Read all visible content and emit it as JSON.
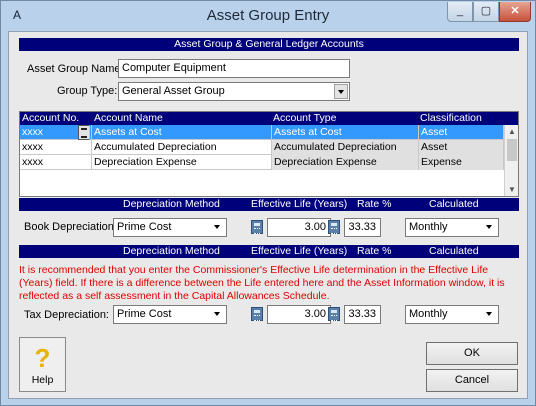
{
  "window": {
    "title": "Asset Group Entry",
    "app_icon": "app-icon"
  },
  "section1": {
    "header": "Asset Group & General Ledger Accounts"
  },
  "form": {
    "name_label": "Asset Group Name:",
    "name_value": "Computer Equipment",
    "type_label": "Group Type:",
    "type_value": "General Asset Group"
  },
  "accounts": {
    "headers": [
      "Account No.",
      "Account Name",
      "Account Type",
      "Classification"
    ],
    "rows": [
      {
        "no": "xxxx",
        "name": "Assets at Cost",
        "type": "Assets at Cost",
        "class": "Asset"
      },
      {
        "no": "xxxx",
        "name": "Accumulated Depreciation",
        "type": "Accumulated Depreciation",
        "class": "Asset"
      },
      {
        "no": "xxxx",
        "name": "Depreciation Expense",
        "type": "Depreciation Expense",
        "class": "Expense"
      }
    ]
  },
  "depr_headers": [
    "Depreciation Method",
    "Effective Life (Years)",
    "Rate %",
    "Calculated"
  ],
  "book": {
    "label": "Book Depreciation:",
    "method": "Prime Cost",
    "life": "3.00",
    "rate": "33.33",
    "calculated": "Monthly"
  },
  "tax": {
    "warning": "It is recommended that you enter the Commissioner's Effective Life determination in the Effective Life (Years) field. If there is a difference between the Life entered here and the Asset Information window, it is reflected as a self assessment in the Capital Allowances Schedule.",
    "label": "Tax Depreciation:",
    "method": "Prime Cost",
    "life": "3.00",
    "rate": "33.33",
    "calculated": "Monthly"
  },
  "buttons": {
    "help": "Help",
    "ok": "OK",
    "cancel": "Cancel"
  }
}
